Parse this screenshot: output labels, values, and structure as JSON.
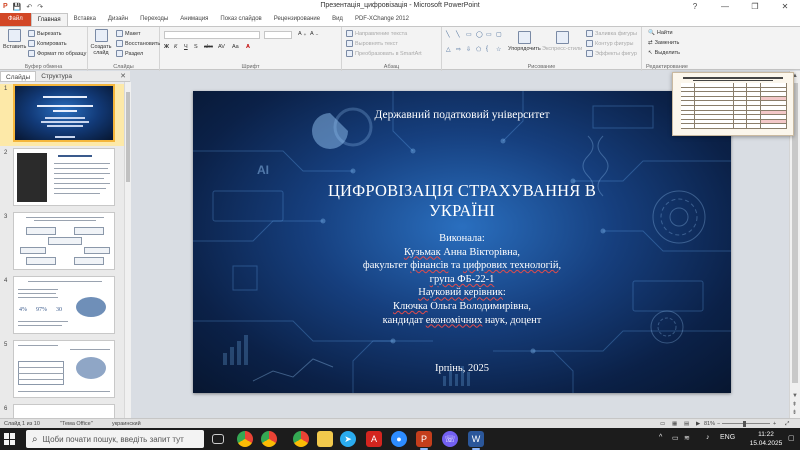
{
  "window": {
    "title": "Презентація_цифровізація - Microsoft PowerPoint",
    "controls": {
      "help": "?",
      "minimize": "—",
      "restore": "❐",
      "close": "✕"
    }
  },
  "quick_access": {
    "app_icon": "P",
    "save": "💾",
    "undo": "↶",
    "redo": "↷"
  },
  "tabs": [
    {
      "label": "Файл",
      "active": false
    },
    {
      "label": "Главная",
      "active": true
    },
    {
      "label": "Вставка",
      "active": false
    },
    {
      "label": "Дизайн",
      "active": false
    },
    {
      "label": "Переходы",
      "active": false
    },
    {
      "label": "Анимация",
      "active": false
    },
    {
      "label": "Показ слайдов",
      "active": false
    },
    {
      "label": "Рецензирование",
      "active": false
    },
    {
      "label": "Вид",
      "active": false
    },
    {
      "label": "PDF-XChange 2012",
      "active": false
    }
  ],
  "ribbon": {
    "clipboard": {
      "label": "Буфер обмена",
      "paste": "Вставить",
      "cut": "Вырезать",
      "copy": "Копировать",
      "format_painter": "Формат по образцу"
    },
    "slides": {
      "label": "Слайды",
      "new_slide": "Создать слайд",
      "layout": "Макет",
      "reset": "Восстановить",
      "section": "Раздел"
    },
    "font": {
      "label": "Шрифт",
      "bold": "Ж",
      "italic": "К",
      "underline": "Ч",
      "shadow": "S",
      "strike": "abc",
      "spacing": "AV",
      "case": "Aa",
      "color": "A"
    },
    "paragraph": {
      "label": "Абзац",
      "direction": "Направление текста",
      "align": "Выровнять текст",
      "smartart": "Преобразовать в SmartArt"
    },
    "drawing": {
      "label": "Рисование",
      "arrange": "Упорядочить",
      "quick_styles": "Экспресс-стили",
      "fill": "Заливка фигуры",
      "outline": "Контур фигуры",
      "effects": "Эффекты фигур"
    },
    "editing": {
      "label": "Редактирование",
      "find": "Найти",
      "replace": "Заменить",
      "select": "Выделить"
    }
  },
  "panel": {
    "tabs": [
      "Слайды",
      "Структура"
    ],
    "close": "✕"
  },
  "thumbnails": [
    {
      "number": "1",
      "selected": true
    },
    {
      "number": "2",
      "selected": false
    },
    {
      "number": "3",
      "selected": false
    },
    {
      "number": "4",
      "selected": false,
      "stat1": "4%",
      "stat2": "97%",
      "stat3": "30"
    },
    {
      "number": "5",
      "selected": false
    },
    {
      "number": "6",
      "selected": false
    }
  ],
  "slide": {
    "university": "Державний податковий університет",
    "title_line1": "ЦИФРОВІЗАЦІЯ СТРАХУВАННЯ В",
    "title_line2": "УКРАЇНІ",
    "performed_label": "Виконала:",
    "author_surname": "Кузьмак",
    "author_name": " Анна Вікторівна,",
    "faculty_pre": "факультет ",
    "faculty_w1": "фінансів",
    "faculty_mid": " та ",
    "faculty_w2": "цифрових технологій",
    "faculty_post": ",",
    "group": "група ФБ-22-1",
    "supervisor_label": "Науковий керівник",
    "supervisor_colon": ":",
    "supervisor_surname": "Ключка",
    "supervisor_name": " Ольга Володимирівна,",
    "degree_pre": "кандидат ",
    "degree_word": "економічних",
    "degree_post": " наук, доцент",
    "footer": "Ірпінь, 2025",
    "ai_label": "AI"
  },
  "status": {
    "slide_of": "Слайд 1 из 10",
    "theme": "\"Тема Office\"",
    "language": "украинский",
    "zoom": "81%",
    "zoom_minus": "−",
    "zoom_plus": "+"
  },
  "taskbar": {
    "search_placeholder": "Щоби почати пошук, введіть запит тут",
    "search_icon": "⌕",
    "tray_chevron": "^",
    "language": "ENG",
    "time": "11:22",
    "date": "15.04.2025"
  },
  "colors": {
    "accent_file_tab": "#d24726",
    "slide_background": "#163f7e",
    "thumbnail_selected": "#f4b63c",
    "taskbar": "#1c1c1c"
  }
}
